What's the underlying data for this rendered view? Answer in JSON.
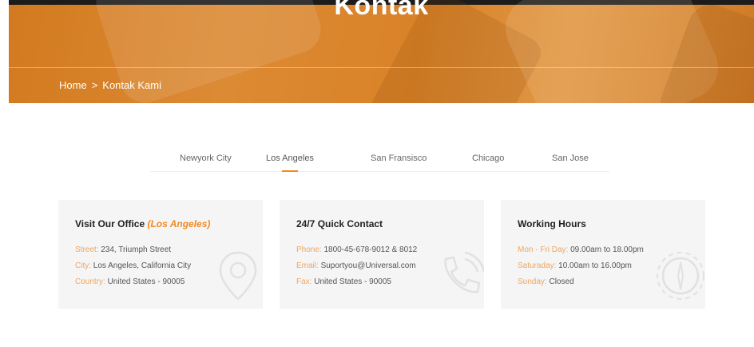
{
  "hero": {
    "title": "Kontak",
    "breadcrumb": {
      "home": "Home",
      "separator": ">",
      "current": "Kontak Kami"
    }
  },
  "tabs": [
    {
      "label": "Newyork City",
      "active": false
    },
    {
      "label": "Los Angeles",
      "active": true
    },
    {
      "label": "San Fransisco",
      "active": false
    },
    {
      "label": "Chicago",
      "active": false
    },
    {
      "label": "San Jose",
      "active": false
    }
  ],
  "cards": {
    "office": {
      "title": "Visit Our Office",
      "location": "(Los Angeles)",
      "rows": [
        {
          "label": "Street:",
          "value": "234, Triumph Street"
        },
        {
          "label": "City:",
          "value": "Los Angeles, California City"
        },
        {
          "label": "Country:",
          "value": "United States - 90005"
        }
      ],
      "icon": "location-pin-icon"
    },
    "contact": {
      "title": "24/7 Quick Contact",
      "rows": [
        {
          "label": "Phone:",
          "value": "1800-45-678-9012 & 8012"
        },
        {
          "label": "Email:",
          "value": "Suportyou@Universal.com"
        },
        {
          "label": "Fax:",
          "value": "United States - 90005"
        }
      ],
      "icon": "phone-icon"
    },
    "hours": {
      "title": "Working Hours",
      "rows": [
        {
          "label": "Mon - Fri Day:",
          "value": "09.00am to 18.00pm"
        },
        {
          "label": "Saturaday:",
          "value": "10.00am to 16.00pm"
        },
        {
          "label": "Sunday:",
          "value": "Closed"
        }
      ],
      "icon": "gear-clock-icon"
    }
  },
  "colors": {
    "accent": "#f08a24",
    "hero": "#d98228",
    "card_bg": "#f5f5f5"
  }
}
